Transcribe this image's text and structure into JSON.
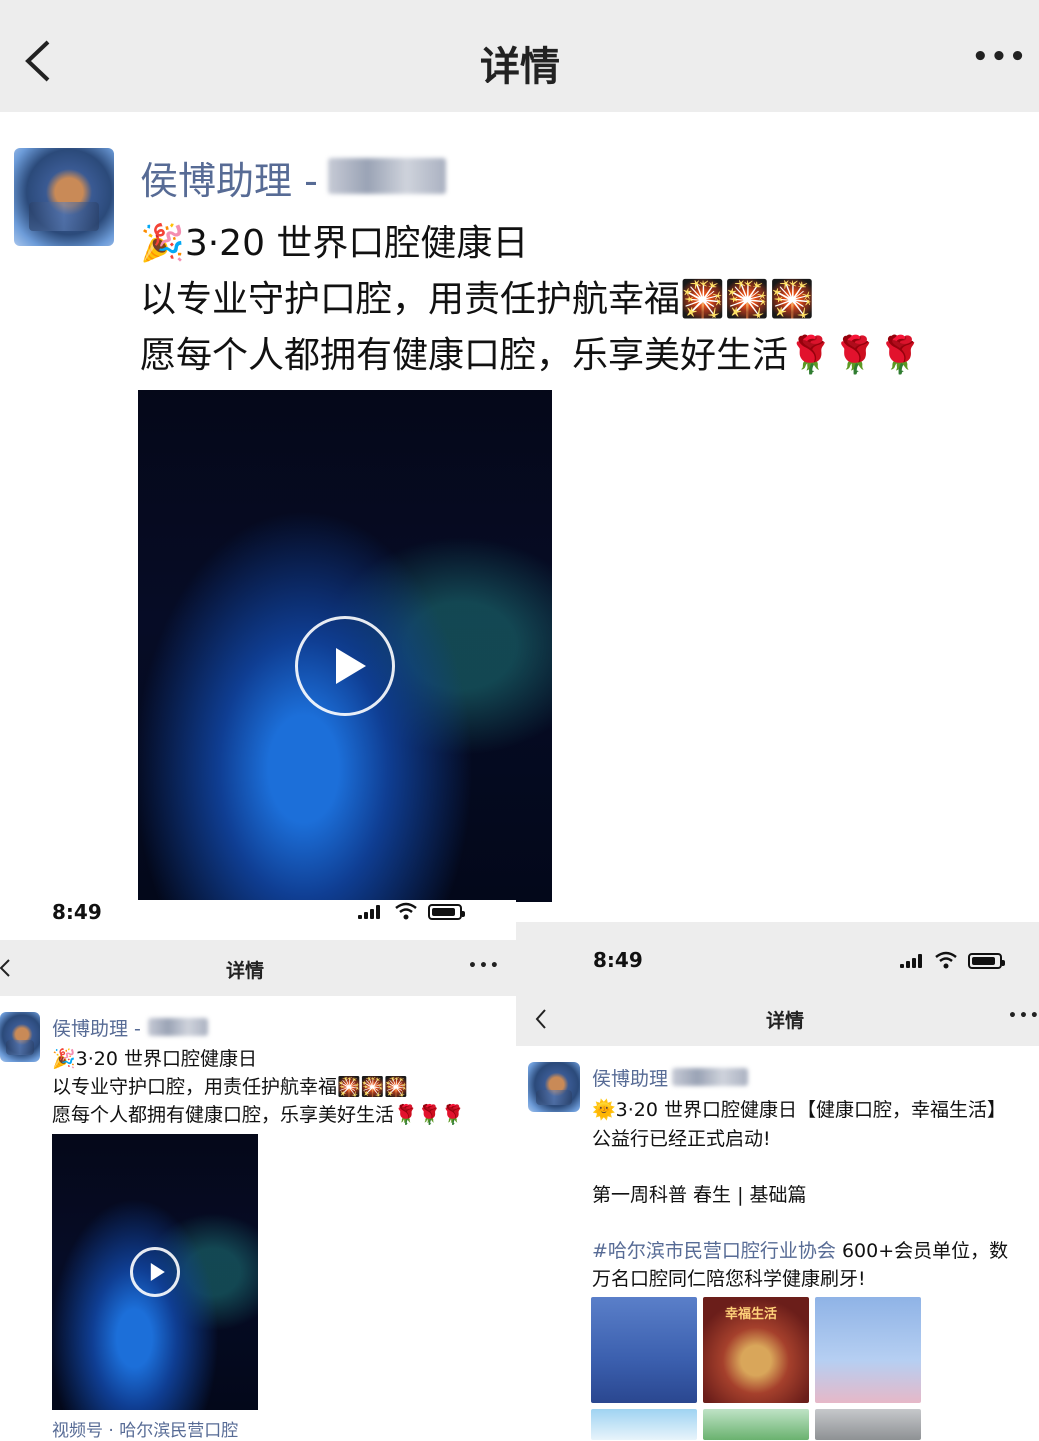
{
  "top": {
    "nav_title": "详情",
    "more": "•••",
    "author": "侯博助理 -",
    "post_lines": [
      "🎉3·20 世界口腔健康日",
      "以专业守护口腔，用责任护航幸福🎇🎇🎇",
      "愿每个人都拥有健康口腔，乐享美好生活🌹🌹🌹"
    ]
  },
  "left_shot": {
    "time": "8:49",
    "nav_title": "详情",
    "more": "•••",
    "author": "侯博助理 -",
    "post_lines": [
      "🎉3·20 世界口腔健康日",
      "以专业守护口腔，用责任护航幸福🎇🎇🎇",
      "愿每个人都拥有健康口腔，乐享美好生活🌹🌹🌹"
    ],
    "channel": "视频号 · 哈尔滨民营口腔"
  },
  "right_shot": {
    "time": "8:49",
    "nav_title": "详情",
    "more": "•••",
    "author": "侯博助理",
    "post_line1": "🌞3·20 世界口腔健康日【健康口腔，幸福生活】",
    "post_line2": "公益行已经正式启动!",
    "week_line": "第一周科普 春生 | 基础篇",
    "hashtag": "#哈尔滨市民营口腔行业协会",
    "hashtag_rest": " 600+会员单位，数",
    "last_line": "万名口腔同仁陪您科学健康刷牙!",
    "thumb_caption": "幸福生活"
  },
  "colors": {
    "link": "#576b95",
    "bar": "#ededed"
  }
}
